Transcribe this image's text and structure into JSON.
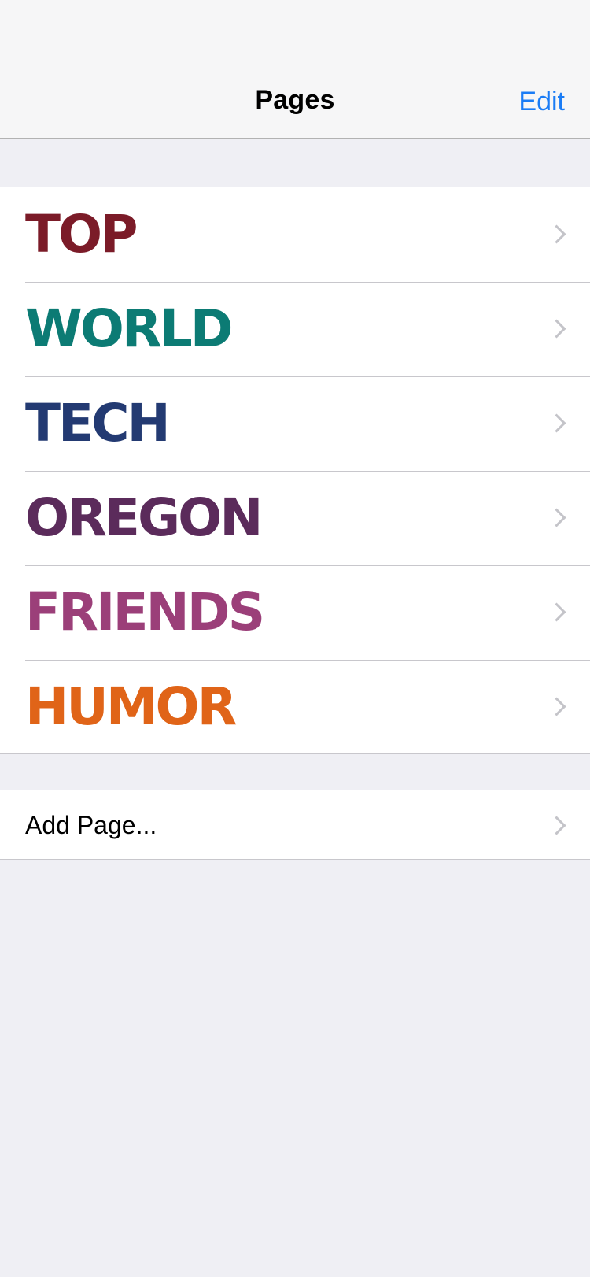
{
  "navbar": {
    "title": "Pages",
    "edit_label": "Edit"
  },
  "pages": [
    {
      "label": "TOP",
      "color": "#7b1b28"
    },
    {
      "label": "WORLD",
      "color": "#0c7b74"
    },
    {
      "label": "TECH",
      "color": "#233a72"
    },
    {
      "label": "OREGON",
      "color": "#5b2b5b"
    },
    {
      "label": "FRIENDS",
      "color": "#9b3f79"
    },
    {
      "label": "HUMOR",
      "color": "#e06418"
    }
  ],
  "add_page": {
    "label": "Add Page..."
  },
  "icons": {
    "disclosure": "chevron-right-icon"
  },
  "colors": {
    "accent": "#1a7cf5",
    "background": "#efeff4",
    "separator": "#c8c7cc"
  }
}
